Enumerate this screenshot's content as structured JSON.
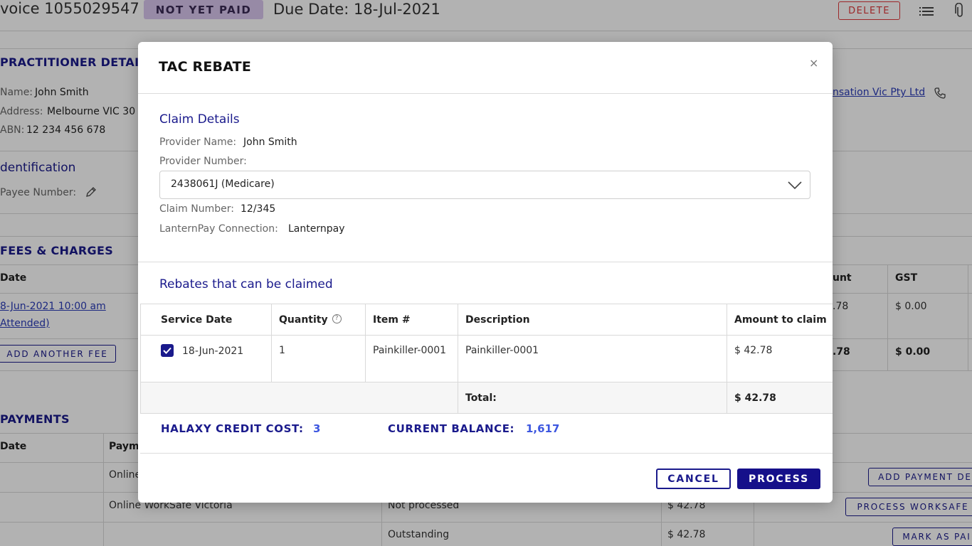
{
  "page": {
    "invoice_title": "voice 1055029547",
    "status_badge": "NOT YET PAID",
    "due_date": "Due Date: 18-Jul-2021",
    "delete_label": "DELETE",
    "practitioner": {
      "title": "PRACTITIONER DETAILS",
      "name_label": "Name:",
      "name_value": "John Smith",
      "address_label": "Address:",
      "address_value": "Melbourne VIC 30",
      "abn_label": "ABN:",
      "abn_value": "12 234 456 678"
    },
    "payer_link": "nsation Vic Pty Ltd",
    "identification": {
      "title": "dentification",
      "payee_label": "Payee Number:"
    },
    "fees": {
      "title": "FEES & CHARGES",
      "col_date": "Date",
      "col_amount": "unt",
      "col_gst": "GST",
      "row_date_line1": "8-Jun-2021 10:00 am",
      "row_date_line2": "Attended)",
      "row_amount": ".78",
      "row_gst": "$ 0.00",
      "total_amount": ".78",
      "total_gst": "$ 0.00",
      "add_fee_label": "ADD ANOTHER FEE"
    },
    "payments": {
      "title": "PAYMENTS",
      "col_date": "Date",
      "col_payment": "Paym",
      "row1_method": "Online",
      "row2_method": "Online WorkSafe Victoria",
      "row2_status": "Not processed",
      "row2_amount": "$ 42.78",
      "row3_status": "Outstanding",
      "row3_amount": "$ 42.78",
      "btn_add_payment": "ADD PAYMENT DE",
      "btn_process_worksafe": "PROCESS WORKSAFE",
      "btn_mark_paid": "MARK AS PAI"
    }
  },
  "modal": {
    "title": "TAC REBATE",
    "close": "×",
    "claim": {
      "heading": "Claim Details",
      "provider_name_label": "Provider Name:",
      "provider_name_value": "John Smith",
      "provider_number_label": "Provider Number:",
      "provider_number_selected": "2438061J (Medicare)",
      "claim_number_label": "Claim Number:",
      "claim_number_value": "12/345",
      "connection_label": "LanternPay Connection:",
      "connection_value": "Lanternpay"
    },
    "rebates": {
      "heading": "Rebates that can be claimed",
      "headers": {
        "service_date": "Service Date",
        "quantity": "Quantity",
        "item": "Item #",
        "description": "Description",
        "amount": "Amount to claim"
      },
      "rows": [
        {
          "checked": true,
          "service_date": "18-Jun-2021",
          "quantity": "1",
          "item": "Painkiller-0001",
          "description": "Painkiller-0001",
          "amount": "$ 42.78"
        }
      ],
      "total_label": "Total:",
      "total_value": "$ 42.78"
    },
    "credit": {
      "cost_label": "HALAXY CREDIT COST:",
      "cost_value": "3",
      "balance_label": "CURRENT BALANCE:",
      "balance_value": "1,617"
    },
    "buttons": {
      "cancel": "CANCEL",
      "process": "PROCESS"
    }
  }
}
